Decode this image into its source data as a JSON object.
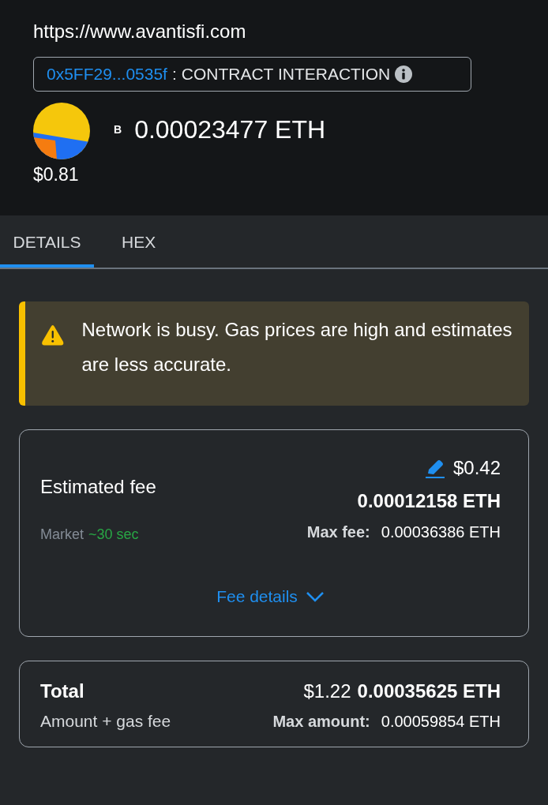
{
  "site": {
    "url": "https://www.avantisfi.com"
  },
  "contract": {
    "address": "0x5FF29...0535f",
    "separator": ":",
    "label": "CONTRACT INTERACTION"
  },
  "amount": {
    "token_symbol": "B",
    "value": "0.00023477 ETH",
    "fiat": "$0.81"
  },
  "tabs": [
    {
      "label": "DETAILS",
      "selected": true
    },
    {
      "label": "HEX",
      "selected": false
    }
  ],
  "alert": {
    "kind": "warning",
    "text": "Network is busy. Gas prices are high and estimates are less accurate."
  },
  "fee": {
    "label": "Estimated fee",
    "fiat": "$0.42",
    "eth": "0.00012158 ETH",
    "speed": "Market",
    "time": "~30 sec",
    "max_label": "Max fee:",
    "max_value": "0.00036386 ETH",
    "details_link": "Fee details"
  },
  "total": {
    "label": "Total",
    "sublabel": "Amount + gas fee",
    "fiat": "$1.22",
    "eth": "0.00035625 ETH",
    "max_label": "Max amount:",
    "max_value": "0.00059854 ETH"
  }
}
